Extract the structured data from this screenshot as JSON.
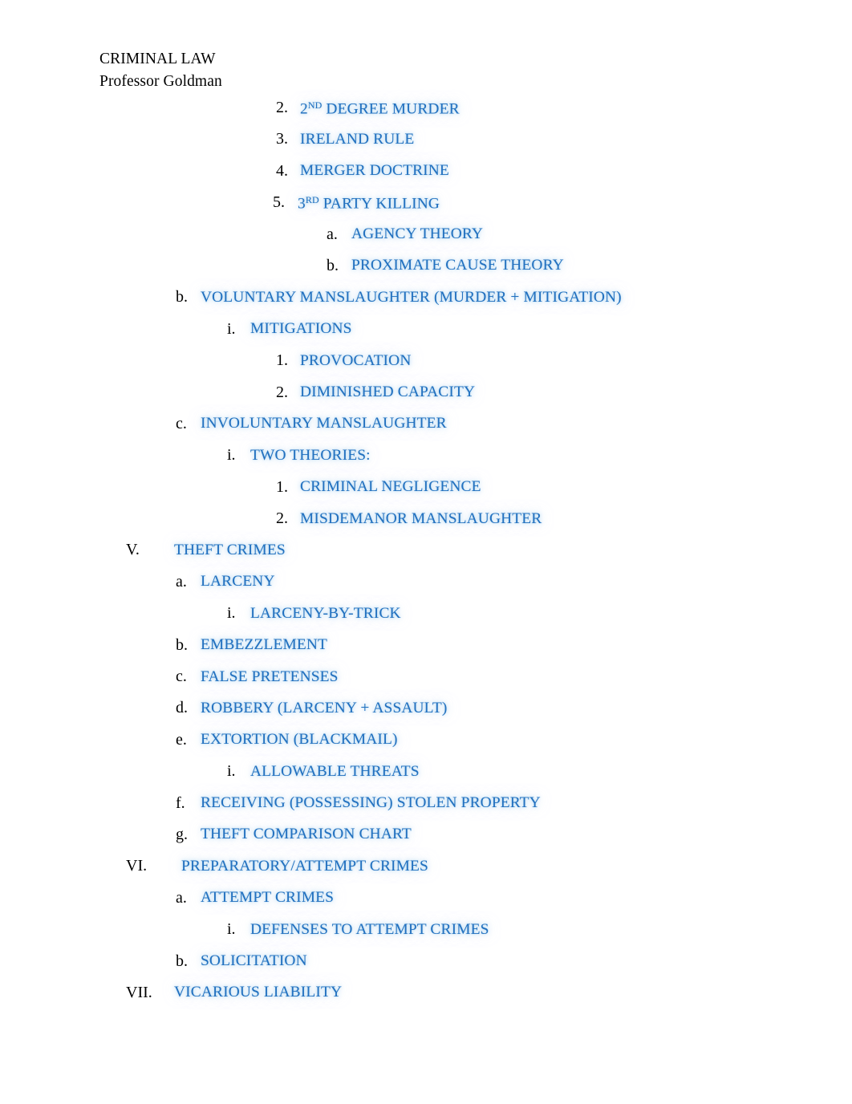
{
  "document": {
    "header": {
      "line1": "CRIMINAL LAW",
      "line2": "Professor Goldman"
    },
    "theme": {
      "text_color": "#2270BF",
      "marker_color": "#000000",
      "page_background": "#ffffff",
      "glow_color": "#A8D3F0"
    },
    "outline": [
      {
        "marker": "2.",
        "text": "2ND DEGREE MURDER",
        "sup": "ND",
        "sup_after": "2"
      },
      {
        "marker": "3.",
        "text": "IRELAND RULE"
      },
      {
        "marker": "4.",
        "text": "MERGER DOCTRINE"
      },
      {
        "marker": "5.",
        "text": "3RD PARTY KILLING",
        "sup": "RD",
        "sup_after": "3"
      },
      {
        "marker": "a.",
        "text": "AGENCY THEORY"
      },
      {
        "marker": "b.",
        "text": "PROXIMATE CAUSE THEORY"
      },
      {
        "marker": "b.",
        "text": "VOLUNTARY MANSLAUGHTER (MURDER + MITIGATION)"
      },
      {
        "marker": "i.",
        "text": "MITIGATIONS"
      },
      {
        "marker": "1.",
        "text": "PROVOCATION"
      },
      {
        "marker": "2.",
        "text": "DIMINISHED CAPACITY"
      },
      {
        "marker": "c.",
        "text": "INVOLUNTARY MANSLAUGHTER"
      },
      {
        "marker": "i.",
        "text": "TWO THEORIES:"
      },
      {
        "marker": "1.",
        "text": "CRIMINAL NEGLIGENCE"
      },
      {
        "marker": "2.",
        "text": "MISDEMANOR MANSLAUGHTER"
      },
      {
        "marker": "V.",
        "text": "THEFT CRIMES"
      },
      {
        "marker": "a.",
        "text": "LARCENY"
      },
      {
        "marker": "i.",
        "text": "LARCENY-BY-TRICK"
      },
      {
        "marker": "b.",
        "text": "EMBEZZLEMENT"
      },
      {
        "marker": "c.",
        "text": "FALSE PRETENSES"
      },
      {
        "marker": "d.",
        "text": "ROBBERY (LARCENY + ASSAULT)"
      },
      {
        "marker": "e.",
        "text": "EXTORTION (BLACKMAIL)"
      },
      {
        "marker": "i.",
        "text": "ALLOWABLE THREATS"
      },
      {
        "marker": "f.",
        "text": "RECEIVING (POSSESSING) STOLEN PROPERTY"
      },
      {
        "marker": "g.",
        "text": "THEFT COMPARISON CHART"
      },
      {
        "marker": "VI.",
        "text": "PREPARATORY/ATTEMPT CRIMES"
      },
      {
        "marker": "a.",
        "text": "ATTEMPT CRIMES"
      },
      {
        "marker": "i.",
        "text": "DEFENSES TO ATTEMPT CRIMES"
      },
      {
        "marker": "b.",
        "text": "SOLICITATION"
      },
      {
        "marker": "VII.",
        "text": "VICARIOUS LIABILITY"
      }
    ]
  }
}
